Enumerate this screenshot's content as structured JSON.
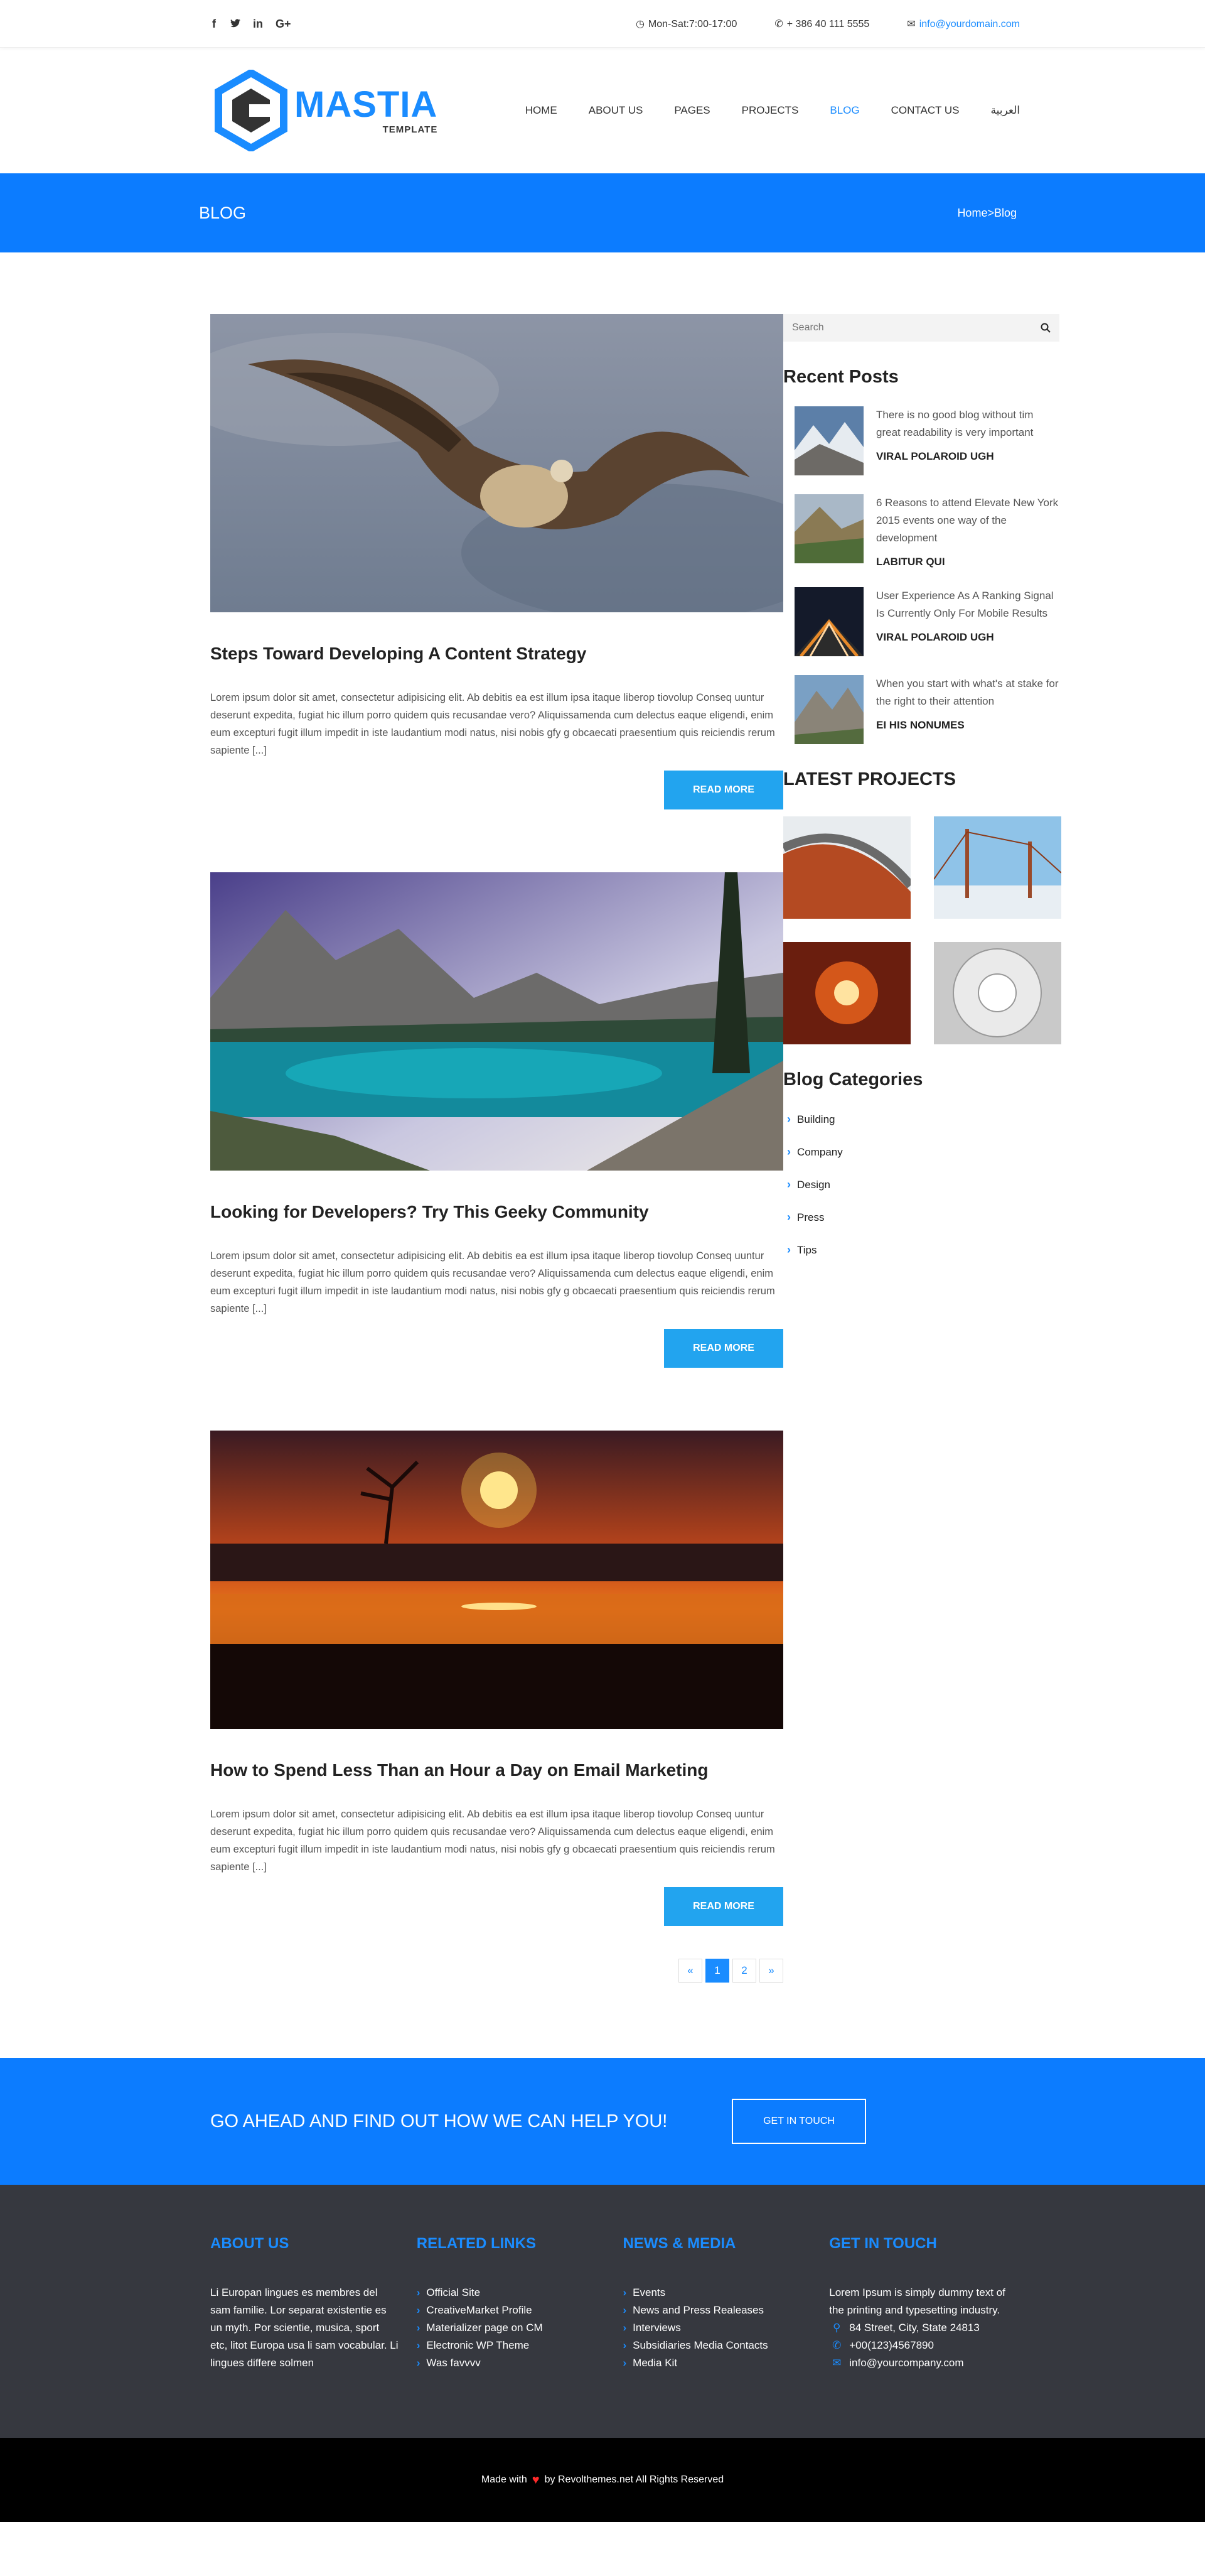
{
  "topbar": {
    "social": [
      "f",
      "t",
      "in",
      "G+"
    ],
    "hours": "Mon-Sat:7:00-17:00",
    "phone": "+ 386 40 111 5555",
    "email": "info@yourdomain.com"
  },
  "header": {
    "logo_name": "MASTIA",
    "logo_tag": "TEMPLATE",
    "nav": [
      "HOME",
      "ABOUT US",
      "PAGES",
      "PROJECTS",
      "BLOG",
      "CONTACT US",
      "العربية"
    ]
  },
  "banner": {
    "title": "BLOG",
    "breadcrumb": "Home>Blog"
  },
  "posts": [
    {
      "title": "Steps Toward Developing A Content Strategy",
      "excerpt": "Lorem ipsum dolor sit amet, consectetur adipisicing elit. Ab debitis ea est illum ipsa itaque liberop tiovolup Conseq uuntur deserunt expedita, fugiat hic illum porro quidem quis recusandae vero? Aliquissamenda cum delectus eaque eligendi, enim eum excepturi fugit illum impedit in iste laudantium modi natus, nisi nobis gfy g obcaecati praesentium quis reiciendis rerum sapiente [...]",
      "button": "READ MORE"
    },
    {
      "title": "Looking for Developers? Try This Geeky Community",
      "excerpt": "Lorem ipsum dolor sit amet, consectetur adipisicing elit. Ab debitis ea est illum ipsa itaque liberop tiovolup Conseq uuntur deserunt expedita, fugiat hic illum porro quidem quis recusandae vero? Aliquissamenda cum delectus eaque eligendi, enim eum excepturi fugit illum impedit in iste laudantium modi natus, nisi nobis gfy g obcaecati praesentium quis reiciendis rerum sapiente [...]",
      "button": "READ MORE"
    },
    {
      "title": "How to Spend Less Than an Hour a Day on Email Marketing",
      "excerpt": "Lorem ipsum dolor sit amet, consectetur adipisicing elit. Ab debitis ea est illum ipsa itaque liberop tiovolup Conseq uuntur deserunt expedita, fugiat hic illum porro quidem quis recusandae vero? Aliquissamenda cum delectus eaque eligendi, enim eum excepturi fugit illum impedit in iste laudantium modi natus, nisi nobis gfy g obcaecati praesentium quis reiciendis rerum sapiente [...]",
      "button": "READ MORE"
    }
  ],
  "pager": {
    "prev": "«",
    "pages": [
      "1",
      "2"
    ],
    "next": "»"
  },
  "sidebar": {
    "search_placeholder": "Search",
    "recent_title": "Recent Posts",
    "recent": [
      {
        "text": "There is no good blog without tim great readability is very important",
        "author": "VIRAL POLAROID UGH"
      },
      {
        "text": "6 Reasons to attend Elevate New York 2015 events one way of the development",
        "author": "LABITUR QUI"
      },
      {
        "text": "User Experience As A Ranking Signal Is Currently Only For Mobile Results",
        "author": "VIRAL POLAROID UGH"
      },
      {
        "text": "When you start with what's at stake for the right to their attention",
        "author": "EI HIS NONUMES"
      }
    ],
    "projects_title": "LATEST PROJECTS",
    "categories_title": "Blog Categories",
    "categories": [
      "Building",
      "Company",
      "Design",
      "Press",
      "Tips"
    ]
  },
  "cta": {
    "text": "GO AHEAD AND FIND OUT HOW WE CAN HELP YOU!",
    "button": "GET IN TOUCH"
  },
  "footer": {
    "about_title": "ABOUT US",
    "about_text": "Li Europan lingues es membres del sam familie. Lor separat existentie es un myth. Por scientie, musica, sport etc, litot Europa usa li sam vocabular. Li lingues differe solmen",
    "links_title": "RELATED LINKS",
    "links": [
      "Official Site",
      "CreativeMarket Profile",
      "Materializer page on CM",
      "Electronic WP Theme",
      "Was favvvv"
    ],
    "news_title": "NEWS & MEDIA",
    "news": [
      "Events",
      "News and Press Realeases",
      "Interviews",
      "Subsidiaries Media Contacts",
      "Media Kit"
    ],
    "touch_title": "GET IN TOUCH",
    "touch_text": "Lorem Ipsum is simply dummy text of the printing and typesetting industry.",
    "address": "84 Street, City, State 24813",
    "phone": "+00(123)4567890",
    "email": "info@yourcompany.com"
  },
  "copyright": {
    "before": "Made with",
    "after": "by Revolthemes.net All Rights Reserved"
  }
}
